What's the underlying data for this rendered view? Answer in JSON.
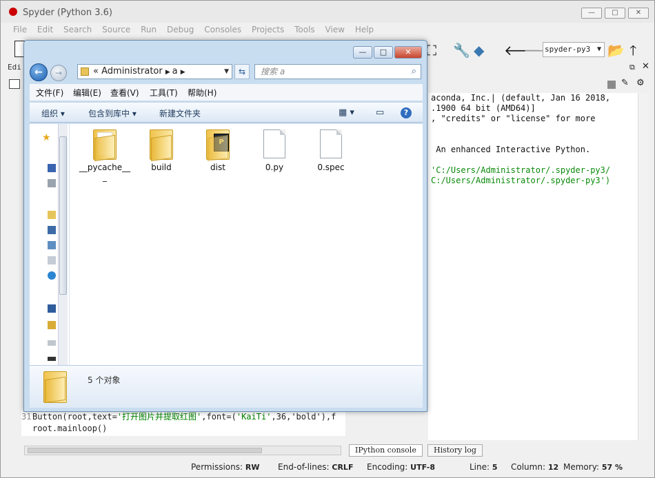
{
  "spyder": {
    "title": "Spyder (Python 3.6)",
    "menu": [
      "File",
      "Edit",
      "Search",
      "Source",
      "Run",
      "Debug",
      "Consoles",
      "Projects",
      "Tools",
      "View",
      "Help"
    ],
    "window_controls": {
      "minimize": "—",
      "maximize": "□",
      "close": "✕"
    },
    "env_selector": "spyder-py3",
    "editor_tab": "Edi",
    "editor": {
      "lines": [
        {
          "num": "31",
          "pre": "Button(root,text=",
          "str": "'打开图片并提取红图'",
          "mid": ",font=(",
          "str2": "'KaiTi'",
          "post": ",36,'bold'),f"
        },
        {
          "num": "",
          "pre": "root.mainloop()",
          "str": "",
          "mid": "",
          "str2": "",
          "post": ""
        }
      ]
    },
    "console": {
      "lines": [
        "aconda, Inc.| (default, Jan 16 2018,",
        ".1900 64 bit (AMD64)]",
        ", \"credits\" or \"license\" for more",
        "",
        "",
        " An enhanced Interactive Python.",
        "",
        "'C:/Users/Administrator/.spyder-py3/",
        "C:/Users/Administrator/.spyder-py3')"
      ],
      "tabs": [
        "IPython console",
        "History log"
      ]
    },
    "status": {
      "permissions_label": "Permissions:",
      "permissions_value": "RW",
      "eol_label": "End-of-lines:",
      "eol_value": "CRLF",
      "encoding_label": "Encoding:",
      "encoding_value": "UTF-8",
      "line_label": "Line:",
      "line_value": "5",
      "column_label": "Column:",
      "column_value": "12",
      "memory_label": "Memory:",
      "memory_value": "57 %"
    }
  },
  "explorer": {
    "address": {
      "chevrons": "«",
      "crumbs": [
        "Administrator",
        "a"
      ]
    },
    "search_placeholder": "搜索 a",
    "menu": [
      "文件(F)",
      "编辑(E)",
      "查看(V)",
      "工具(T)",
      "帮助(H)"
    ],
    "commands": {
      "organize": "组织 ▾",
      "include": "包含到库中 ▾",
      "new_folder": "新建文件夹"
    },
    "items": [
      {
        "name": "__pycache__",
        "kind": "folder"
      },
      {
        "name": "build",
        "kind": "folder"
      },
      {
        "name": "dist",
        "kind": "folder-python"
      },
      {
        "name": "0.py",
        "kind": "file"
      },
      {
        "name": "0.spec",
        "kind": "file"
      }
    ],
    "item_count_text": "5 个对象"
  }
}
